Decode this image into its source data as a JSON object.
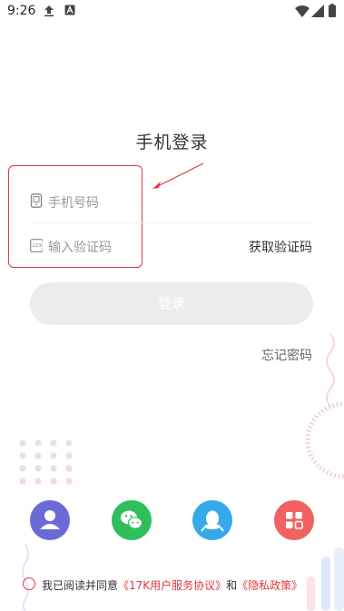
{
  "status_bar": {
    "time": "9:26"
  },
  "title": "手机登录",
  "phone_field": {
    "placeholder": "手机号码",
    "icon": "phone-icon"
  },
  "code_field": {
    "placeholder": "输入验证码",
    "icon": "keypad-icon"
  },
  "get_code_label": "获取验证码",
  "login_label": "登录",
  "forgot_label": "忘记密码",
  "social_buttons": [
    {
      "name": "account-login",
      "color": "#6b6bd8"
    },
    {
      "name": "wechat-login",
      "color": "#2fbf5a"
    },
    {
      "name": "qq-login",
      "color": "#36a9ea"
    },
    {
      "name": "more-login",
      "color": "#f06262"
    }
  ],
  "agreement": {
    "prefix": "我已阅读并同意",
    "user_agreement": "《17K用户服务协议》",
    "and": "和",
    "privacy_policy": "《隐私政策》"
  },
  "colors": {
    "accent": "#e0393e",
    "button_disabled": "#ececec"
  }
}
